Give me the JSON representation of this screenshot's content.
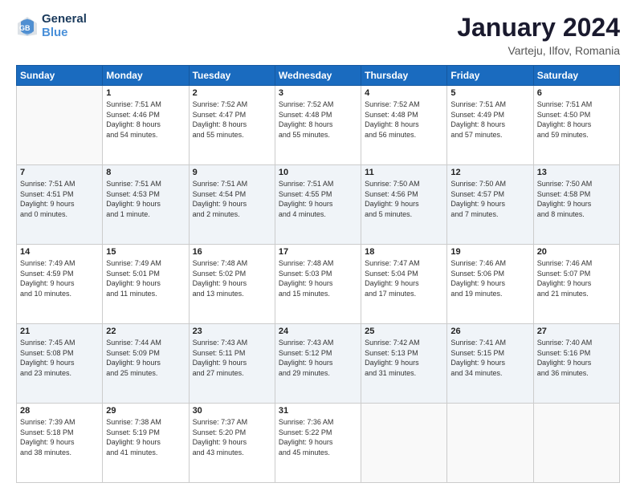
{
  "header": {
    "logo_line1": "General",
    "logo_line2": "Blue",
    "title": "January 2024",
    "subtitle": "Varteju, Ilfov, Romania"
  },
  "days_of_week": [
    "Sunday",
    "Monday",
    "Tuesday",
    "Wednesday",
    "Thursday",
    "Friday",
    "Saturday"
  ],
  "weeks": [
    [
      {
        "day": "",
        "info": ""
      },
      {
        "day": "1",
        "info": "Sunrise: 7:51 AM\nSunset: 4:46 PM\nDaylight: 8 hours\nand 54 minutes."
      },
      {
        "day": "2",
        "info": "Sunrise: 7:52 AM\nSunset: 4:47 PM\nDaylight: 8 hours\nand 55 minutes."
      },
      {
        "day": "3",
        "info": "Sunrise: 7:52 AM\nSunset: 4:48 PM\nDaylight: 8 hours\nand 55 minutes."
      },
      {
        "day": "4",
        "info": "Sunrise: 7:52 AM\nSunset: 4:48 PM\nDaylight: 8 hours\nand 56 minutes."
      },
      {
        "day": "5",
        "info": "Sunrise: 7:51 AM\nSunset: 4:49 PM\nDaylight: 8 hours\nand 57 minutes."
      },
      {
        "day": "6",
        "info": "Sunrise: 7:51 AM\nSunset: 4:50 PM\nDaylight: 8 hours\nand 59 minutes."
      }
    ],
    [
      {
        "day": "7",
        "info": "Sunrise: 7:51 AM\nSunset: 4:51 PM\nDaylight: 9 hours\nand 0 minutes."
      },
      {
        "day": "8",
        "info": "Sunrise: 7:51 AM\nSunset: 4:53 PM\nDaylight: 9 hours\nand 1 minute."
      },
      {
        "day": "9",
        "info": "Sunrise: 7:51 AM\nSunset: 4:54 PM\nDaylight: 9 hours\nand 2 minutes."
      },
      {
        "day": "10",
        "info": "Sunrise: 7:51 AM\nSunset: 4:55 PM\nDaylight: 9 hours\nand 4 minutes."
      },
      {
        "day": "11",
        "info": "Sunrise: 7:50 AM\nSunset: 4:56 PM\nDaylight: 9 hours\nand 5 minutes."
      },
      {
        "day": "12",
        "info": "Sunrise: 7:50 AM\nSunset: 4:57 PM\nDaylight: 9 hours\nand 7 minutes."
      },
      {
        "day": "13",
        "info": "Sunrise: 7:50 AM\nSunset: 4:58 PM\nDaylight: 9 hours\nand 8 minutes."
      }
    ],
    [
      {
        "day": "14",
        "info": "Sunrise: 7:49 AM\nSunset: 4:59 PM\nDaylight: 9 hours\nand 10 minutes."
      },
      {
        "day": "15",
        "info": "Sunrise: 7:49 AM\nSunset: 5:01 PM\nDaylight: 9 hours\nand 11 minutes."
      },
      {
        "day": "16",
        "info": "Sunrise: 7:48 AM\nSunset: 5:02 PM\nDaylight: 9 hours\nand 13 minutes."
      },
      {
        "day": "17",
        "info": "Sunrise: 7:48 AM\nSunset: 5:03 PM\nDaylight: 9 hours\nand 15 minutes."
      },
      {
        "day": "18",
        "info": "Sunrise: 7:47 AM\nSunset: 5:04 PM\nDaylight: 9 hours\nand 17 minutes."
      },
      {
        "day": "19",
        "info": "Sunrise: 7:46 AM\nSunset: 5:06 PM\nDaylight: 9 hours\nand 19 minutes."
      },
      {
        "day": "20",
        "info": "Sunrise: 7:46 AM\nSunset: 5:07 PM\nDaylight: 9 hours\nand 21 minutes."
      }
    ],
    [
      {
        "day": "21",
        "info": "Sunrise: 7:45 AM\nSunset: 5:08 PM\nDaylight: 9 hours\nand 23 minutes."
      },
      {
        "day": "22",
        "info": "Sunrise: 7:44 AM\nSunset: 5:09 PM\nDaylight: 9 hours\nand 25 minutes."
      },
      {
        "day": "23",
        "info": "Sunrise: 7:43 AM\nSunset: 5:11 PM\nDaylight: 9 hours\nand 27 minutes."
      },
      {
        "day": "24",
        "info": "Sunrise: 7:43 AM\nSunset: 5:12 PM\nDaylight: 9 hours\nand 29 minutes."
      },
      {
        "day": "25",
        "info": "Sunrise: 7:42 AM\nSunset: 5:13 PM\nDaylight: 9 hours\nand 31 minutes."
      },
      {
        "day": "26",
        "info": "Sunrise: 7:41 AM\nSunset: 5:15 PM\nDaylight: 9 hours\nand 34 minutes."
      },
      {
        "day": "27",
        "info": "Sunrise: 7:40 AM\nSunset: 5:16 PM\nDaylight: 9 hours\nand 36 minutes."
      }
    ],
    [
      {
        "day": "28",
        "info": "Sunrise: 7:39 AM\nSunset: 5:18 PM\nDaylight: 9 hours\nand 38 minutes."
      },
      {
        "day": "29",
        "info": "Sunrise: 7:38 AM\nSunset: 5:19 PM\nDaylight: 9 hours\nand 41 minutes."
      },
      {
        "day": "30",
        "info": "Sunrise: 7:37 AM\nSunset: 5:20 PM\nDaylight: 9 hours\nand 43 minutes."
      },
      {
        "day": "31",
        "info": "Sunrise: 7:36 AM\nSunset: 5:22 PM\nDaylight: 9 hours\nand 45 minutes."
      },
      {
        "day": "",
        "info": ""
      },
      {
        "day": "",
        "info": ""
      },
      {
        "day": "",
        "info": ""
      }
    ]
  ]
}
